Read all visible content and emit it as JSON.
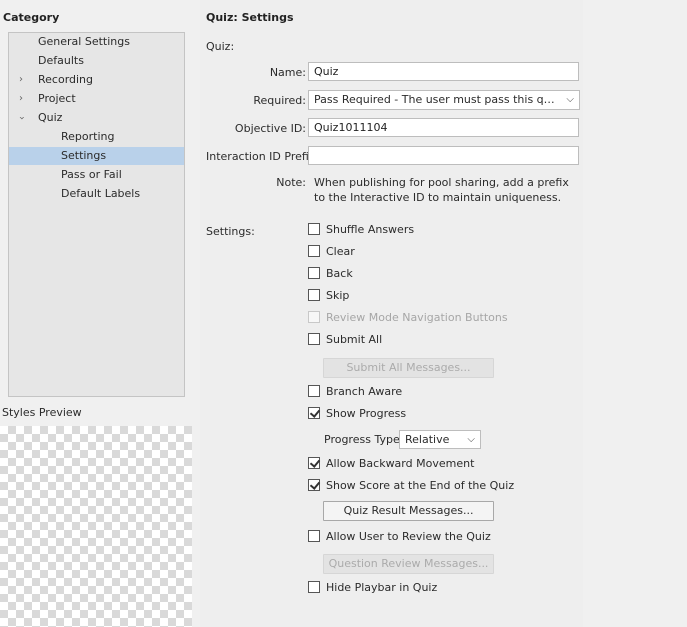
{
  "left": {
    "category_heading": "Category",
    "tree": [
      {
        "label": "General Settings",
        "indent": 0,
        "expander": "",
        "selected": false
      },
      {
        "label": "Defaults",
        "indent": 0,
        "expander": "",
        "selected": false
      },
      {
        "label": "Recording",
        "indent": 0,
        "expander": "collapsed",
        "selected": false
      },
      {
        "label": "Project",
        "indent": 0,
        "expander": "collapsed",
        "selected": false
      },
      {
        "label": "Quiz",
        "indent": 0,
        "expander": "expanded",
        "selected": false
      },
      {
        "label": "Reporting",
        "indent": 1,
        "expander": "",
        "selected": false
      },
      {
        "label": "Settings",
        "indent": 1,
        "expander": "",
        "selected": true
      },
      {
        "label": "Pass or Fail",
        "indent": 1,
        "expander": "",
        "selected": false
      },
      {
        "label": "Default Labels",
        "indent": 1,
        "expander": "",
        "selected": false
      }
    ],
    "styles_preview_heading": "Styles Preview"
  },
  "main": {
    "title": "Quiz: Settings",
    "section_quiz": "Quiz:",
    "name_label": "Name:",
    "name_value": "Quiz",
    "required_label": "Required:",
    "required_value": "Pass Required - The user must pass this quiz to continue",
    "objective_label": "Objective ID:",
    "objective_value": "Quiz1011104",
    "interaction_label": "Interaction ID Prefix:",
    "interaction_value": "",
    "note_label": "Note:",
    "note_line1": "When publishing for pool sharing, add a prefix",
    "note_line2": "to the Interactive ID to maintain uniqueness.",
    "settings_label": "Settings:",
    "checkboxes": {
      "shuffle": {
        "label": "Shuffle Answers",
        "checked": false,
        "disabled": false
      },
      "clear": {
        "label": "Clear",
        "checked": false,
        "disabled": false
      },
      "back": {
        "label": "Back",
        "checked": false,
        "disabled": false
      },
      "skip": {
        "label": "Skip",
        "checked": false,
        "disabled": false
      },
      "review_nav": {
        "label": "Review Mode Navigation Buttons",
        "checked": false,
        "disabled": true
      },
      "submit_all": {
        "label": "Submit All",
        "checked": false,
        "disabled": false
      },
      "branch_aware": {
        "label": "Branch Aware",
        "checked": false,
        "disabled": false
      },
      "show_progress": {
        "label": "Show Progress",
        "checked": true,
        "disabled": false
      },
      "backward": {
        "label": "Allow Backward Movement",
        "checked": true,
        "disabled": false
      },
      "show_score": {
        "label": "Show Score at the End of the Quiz",
        "checked": true,
        "disabled": false
      },
      "allow_review": {
        "label": "Allow User to Review the Quiz",
        "checked": false,
        "disabled": false
      },
      "hide_playbar": {
        "label": "Hide Playbar in Quiz",
        "checked": false,
        "disabled": false
      }
    },
    "submit_all_messages_btn": "Submit All Messages...",
    "progress_type_label": "Progress Type:",
    "progress_type_value": "Relative",
    "quiz_result_messages_btn": "Quiz Result Messages...",
    "question_review_messages_btn": "Question Review Messages..."
  }
}
